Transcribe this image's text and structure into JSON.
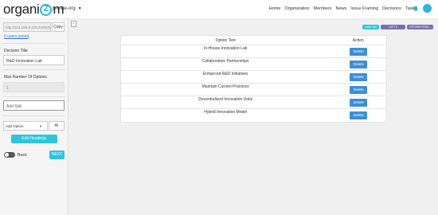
{
  "header": {
    "logo_prefix": "organi",
    "logo_circle_letter": "Z",
    "logo_suffix": "m",
    "org_name": "private-org",
    "nav": [
      "Home",
      "Organization",
      "Members",
      "News",
      "Issue Framing",
      "Decisions",
      "Tasks"
    ]
  },
  "sidebar": {
    "url": "http://112.168.9.125:4200/dec",
    "copy_label": "Copy",
    "users_joined": "0 users joined",
    "decision_title_label": "Decision Title",
    "decision_title_value": "R&D Innovation Lab",
    "max_options_label": "Max Number Of Options",
    "max_options_value": "1",
    "add_skill_placeholder": "Add Skill",
    "add_option_label": "Add Option",
    "ai_label": "AI",
    "edit_headings_label": "Edit Headings",
    "toggle_label": "Basic",
    "next_label": "NEXT"
  },
  "main": {
    "badges": {
      "invite": "Invite User",
      "left": "LEFT 0",
      "options": "OPTIONS PEND..."
    },
    "table": {
      "headers": [
        "Option Text",
        "Action"
      ],
      "delete_label": "Delete",
      "rows": [
        "In-House Innovation Lab",
        "Collaborative Partnerships",
        "Enhanced R&D Initiatives",
        "Maintain Current Practices",
        "Decentralized Innovation Units",
        "Hybrid Innovation Model"
      ]
    }
  },
  "colors": {
    "accent": "#2bc6dc",
    "primary_button": "#3b8fd9",
    "badge_purple": "#7a6fb5"
  }
}
